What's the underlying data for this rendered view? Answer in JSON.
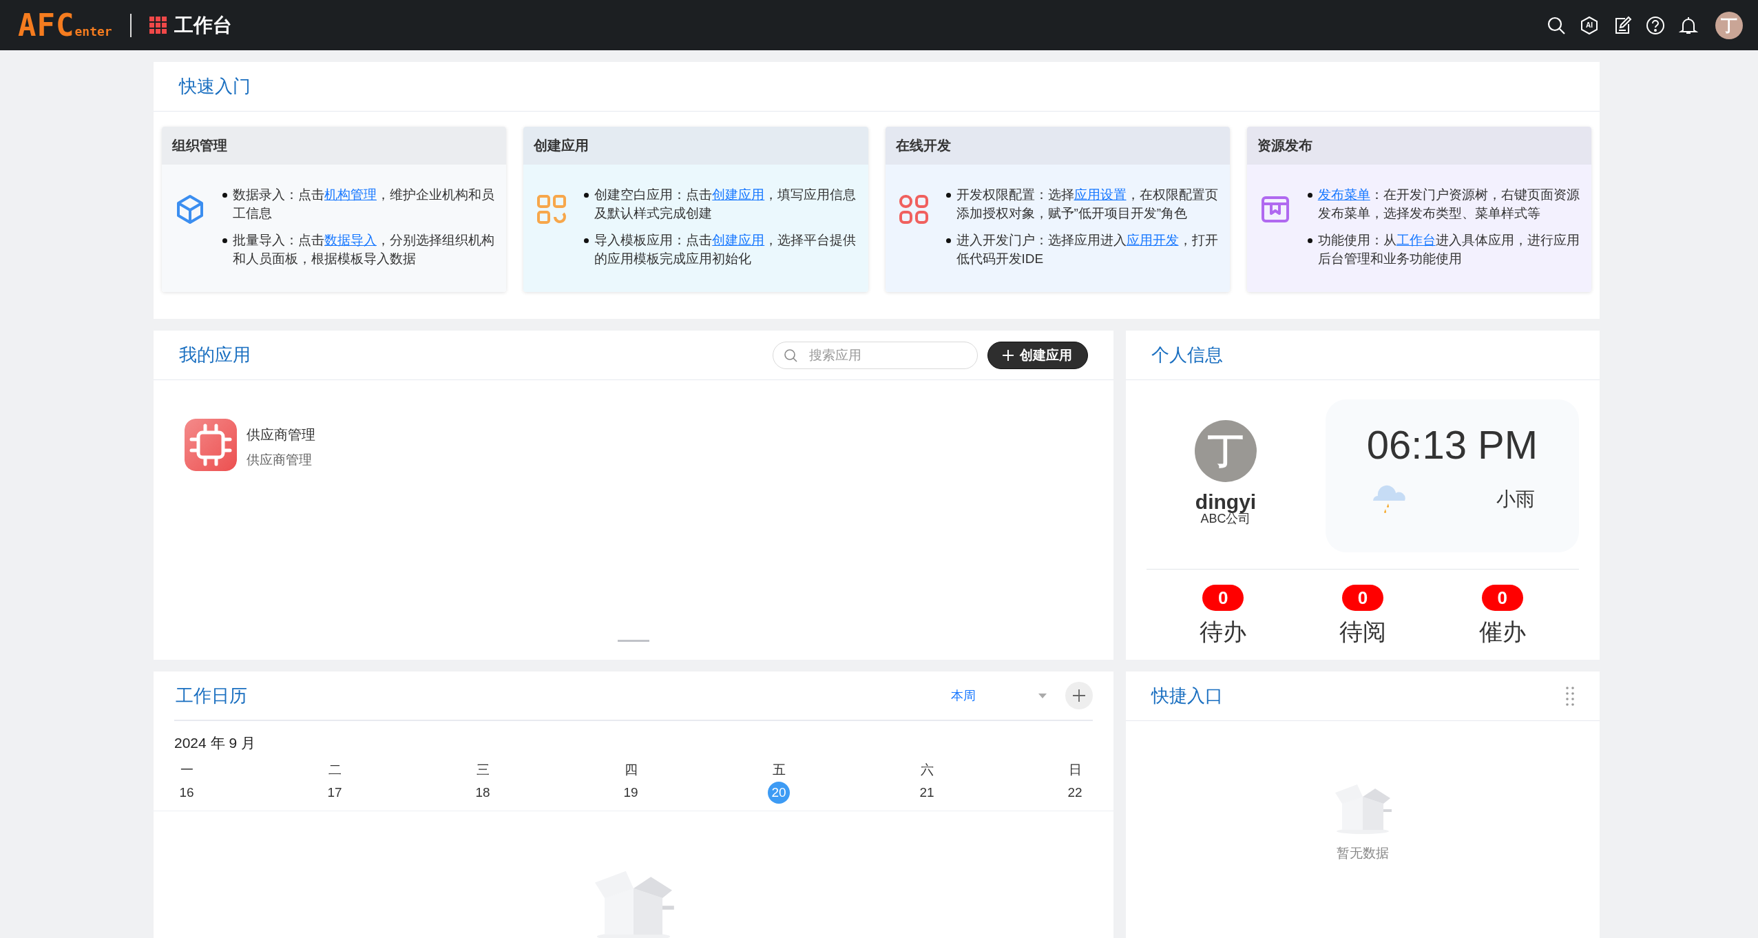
{
  "header": {
    "logo": {
      "main": "AFC",
      "sub": "enter"
    },
    "title": "工作台",
    "tools": [
      {
        "kind": "search"
      },
      {
        "kind": "ai",
        "label": "AI"
      },
      {
        "kind": "edit"
      },
      {
        "kind": "help"
      },
      {
        "kind": "bell"
      }
    ],
    "avatar": "丁"
  },
  "quick_start": {
    "title": "快速入门",
    "cards": [
      {
        "kind": "org",
        "title": "组织管理",
        "color": "#3b8ef0",
        "items": [
          {
            "prefix": "数据录入：点击",
            "link": "机构管理",
            "suffix": "，维护企业机构和员工信息"
          },
          {
            "prefix": "批量导入：点击",
            "link": "数据导入",
            "suffix": "，分别选择组织机构和人员面板，根据模板导入数据"
          }
        ]
      },
      {
        "kind": "app",
        "title": "创建应用",
        "color": "#f7a74b",
        "items": [
          {
            "prefix": "创建空白应用：点击",
            "link": "创建应用",
            "suffix": "，填写应用信息及默认样式完成创建"
          },
          {
            "prefix": "导入模板应用：点击",
            "link": "创建应用",
            "suffix": "，选择平台提供的应用模板完成应用初始化"
          }
        ]
      },
      {
        "kind": "dev",
        "title": "在线开发",
        "color": "#f0605e",
        "items": [
          {
            "prefix": "开发权限配置：选择",
            "link": "应用设置",
            "suffix": "，在权限配置页添加授权对象，赋予”低开项目开发”角色"
          },
          {
            "prefix": "进入开发门户：选择应用进入",
            "link": "应用开发",
            "suffix": "，打开低代码开发IDE"
          }
        ]
      },
      {
        "kind": "publish",
        "title": "资源发布",
        "color": "#b069f0",
        "items": [
          {
            "link": "发布菜单",
            "suffix": "：在开发门户资源树，右键页面资源发布菜单，选择发布类型、菜单样式等"
          },
          {
            "prefix": "功能使用：从",
            "link": "工作台",
            "suffix": "进入具体应用，进行应用后台管理和业务功能使用"
          }
        ]
      }
    ]
  },
  "my_apps": {
    "title": "我的应用",
    "search": {
      "placeholder": "搜索应用"
    },
    "create_button": "创建应用",
    "apps": [
      {
        "name": "供应商管理",
        "subtitle": "供应商管理"
      }
    ]
  },
  "profile": {
    "title": "个人信息",
    "avatar": "丁",
    "name": "dingyi",
    "company": "ABC公司",
    "time": "06:13 PM",
    "weather": "小雨",
    "counters": [
      {
        "count": "0",
        "label": "待办"
      },
      {
        "count": "0",
        "label": "待阅"
      },
      {
        "count": "0",
        "label": "催办"
      }
    ]
  },
  "calendar": {
    "title": "工作日历",
    "range": "本周",
    "month": "2024 年 9 月",
    "days": [
      {
        "weekday": "一",
        "date": "16",
        "selected": false
      },
      {
        "weekday": "二",
        "date": "17",
        "selected": false
      },
      {
        "weekday": "三",
        "date": "18",
        "selected": false
      },
      {
        "weekday": "四",
        "date": "19",
        "selected": false
      },
      {
        "weekday": "五",
        "date": "20",
        "selected": true
      },
      {
        "weekday": "六",
        "date": "21",
        "selected": false
      },
      {
        "weekday": "日",
        "date": "22",
        "selected": false
      }
    ]
  },
  "shortcuts": {
    "title": "快捷入口",
    "empty": "暂无数据"
  }
}
